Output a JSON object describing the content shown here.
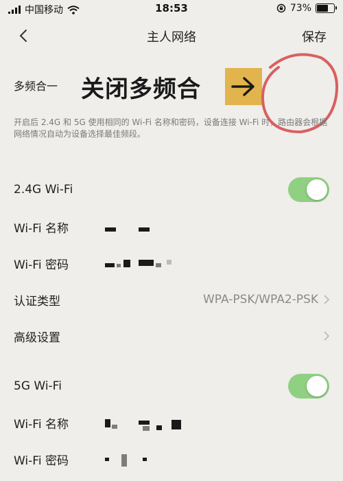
{
  "status": {
    "carrier": "中国移动",
    "time": "18:53",
    "battery": "73%",
    "battery_level": 0.73
  },
  "nav": {
    "back_icon": "chevron-left-icon",
    "title": "主人网络",
    "save": "保存"
  },
  "multi_band": {
    "label": "多频合一",
    "enabled": false,
    "description": "开启后 2.4G 和 5G 使用相同的 Wi-Fi 名称和密码，设备连接 Wi-Fi 时，路由器会根据网络情况自动为设备选择最佳频段。"
  },
  "annotation": {
    "text": "关闭多频合",
    "arrow_icon": "arrow-right-icon",
    "arrow_color": "#e1b44d",
    "circle_color": "#d9605e"
  },
  "wifi_24": {
    "label": "2.4G Wi-Fi",
    "enabled": true,
    "name_label": "Wi-Fi 名称",
    "password_label": "Wi-Fi 密码",
    "auth_label": "认证类型",
    "auth_value": "WPA-PSK/WPA2-PSK",
    "advanced_label": "高级设置"
  },
  "wifi_5": {
    "label": "5G Wi-Fi",
    "enabled": true,
    "name_label": "Wi-Fi 名称",
    "password_label": "Wi-Fi 密码"
  },
  "colors": {
    "toggle_on": "#8fd083",
    "background": "#efeeeb"
  }
}
